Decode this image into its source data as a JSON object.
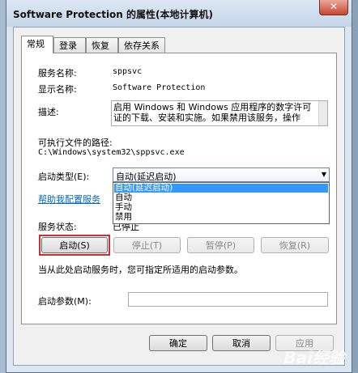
{
  "window": {
    "title": "Software Protection 的属性(本地计算机)",
    "close": "✕"
  },
  "tabs": [
    "常规",
    "登录",
    "恢复",
    "依存关系"
  ],
  "general": {
    "service_name_label": "服务名称:",
    "service_name": "sppsvc",
    "display_name_label": "显示名称:",
    "display_name": "Software Protection",
    "description_label": "描述:",
    "description": "启用 Windows 和 Windows 应用程序的数字许可证的下载、安装和实施。如果禁用该服务，操作",
    "path_label": "可执行文件的路径:",
    "path": "C:\\Windows\\system32\\sppsvc.exe",
    "startup_type_label": "启动类型(E):",
    "startup_type_value": "自动(延迟启动)",
    "startup_options": [
      "自动(延迟启动)",
      "自动",
      "手动",
      "禁用"
    ],
    "help_link": "帮助我配置服务",
    "status_label": "服务状态:",
    "status_value": "已停止",
    "start_button": "启动(S)",
    "stop_button": "停止(T)",
    "pause_button": "暂停(P)",
    "resume_button": "恢复(R)",
    "hint": "当从此处启动服务时，您可指定所适用的启动参数。",
    "params_label": "启动参数(M):",
    "params_value": ""
  },
  "footer": {
    "ok": "确定",
    "cancel": "取消",
    "apply": "应用"
  },
  "watermark": "Bai经验"
}
